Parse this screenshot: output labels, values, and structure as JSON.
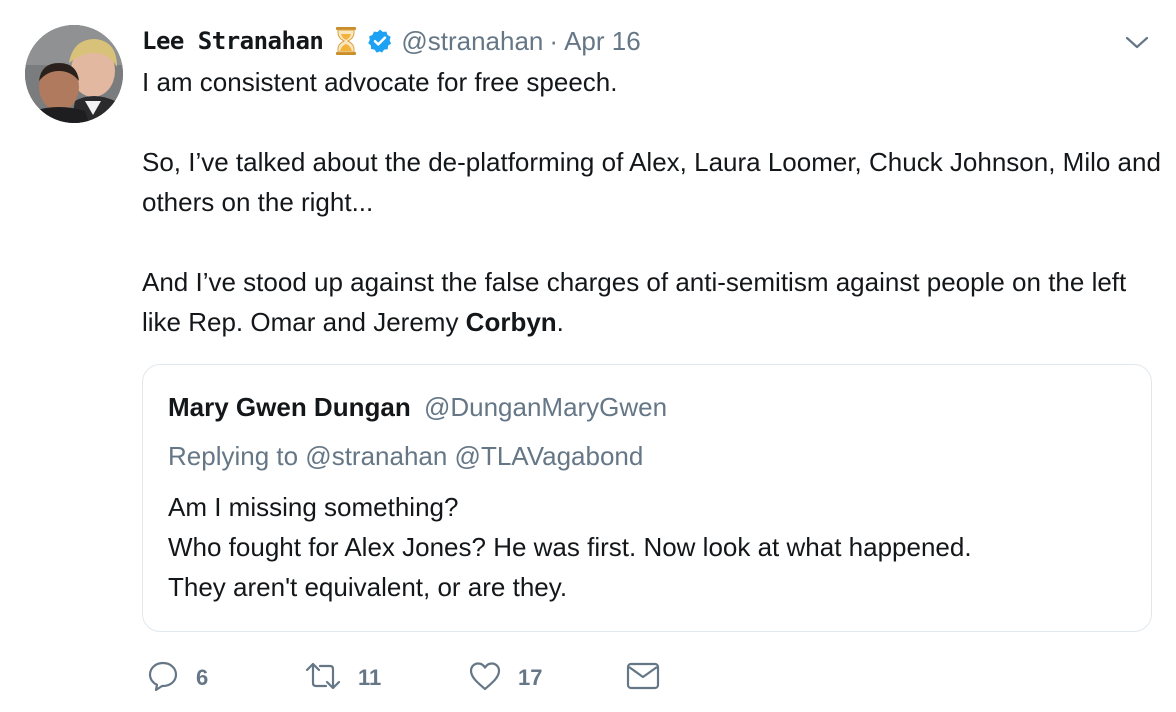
{
  "tweet": {
    "author": {
      "display_name": "Lee Stranahan",
      "handle": "@stranahan",
      "emoji_icon": "hourglass-icon",
      "verified_icon": "verified-badge-icon"
    },
    "separator": "·",
    "date": "Apr 16",
    "text": {
      "line1": "I am consistent advocate for free speech.",
      "para2": "So, I’ve talked about the de-platforming of Alex, Laura Loomer, Chuck Johnson, Milo and others on the right...",
      "para3_start": "And I’ve stood up against the false charges of anti-semitism against people on the left like Rep. Omar and Jeremy ",
      "para3_bold": "Corbyn",
      "para3_end": "."
    },
    "quoted_tweet": {
      "display_name": "Mary Gwen Dungan",
      "handle": "@DunganMaryGwen",
      "replying_to": "Replying to @stranahan @TLAVagabond",
      "lines": [
        "Am I missing something?",
        "Who fought for Alex Jones? He was first. Now look at what happened.",
        "They aren't equivalent, or are they."
      ]
    },
    "actions": {
      "reply_count": "6",
      "retweet_count": "11",
      "like_count": "17"
    }
  },
  "colors": {
    "text": "#14171a",
    "secondary": "#657786",
    "verified": "#1da1f2",
    "border": "#e1e8ed"
  }
}
